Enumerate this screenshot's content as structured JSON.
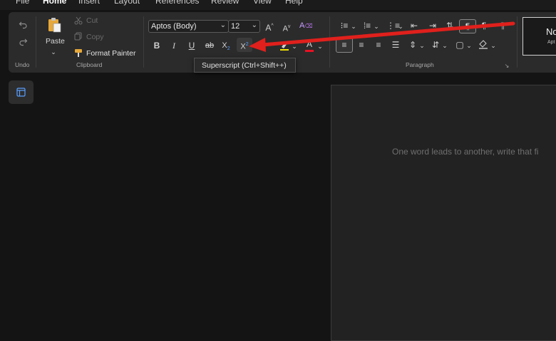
{
  "tabs": [
    "File",
    "Home",
    "Insert",
    "Layout",
    "References",
    "Review",
    "View",
    "Help"
  ],
  "undo": {
    "group_label": "Undo"
  },
  "clipboard": {
    "paste_label": "Paste",
    "cut_label": "Cut",
    "copy_label": "Copy",
    "format_painter_label": "Format Painter",
    "group_label": "Clipboard"
  },
  "font": {
    "font_name": "Aptos (Body)",
    "font_size": "12",
    "bold": "B",
    "italic": "I",
    "underline": "U",
    "strikethrough": "ab",
    "subscript": "X",
    "superscript": "X",
    "font_color_letter": "A",
    "highlight_color": "#f2e200",
    "font_color": "#e81123"
  },
  "paragraph": {
    "group_label": "Paragraph"
  },
  "styles": {
    "normal_label": "No",
    "normal_font": "Apt"
  },
  "tooltip": {
    "text": "Superscript (Ctrl+Shift++)"
  },
  "document": {
    "placeholder": "One word leads to another, write that fi"
  },
  "annotation": {
    "arrow_color": "#e0201c"
  }
}
